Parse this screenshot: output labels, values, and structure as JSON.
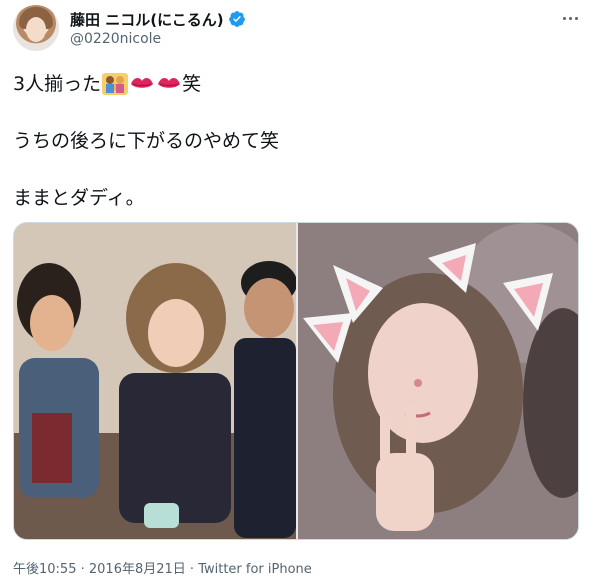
{
  "tweet": {
    "display_name": "藤田 ニコル(にこるん)",
    "handle": "@0220nicole",
    "lines": [
      "3人揃った",
      "笑",
      "うちの後ろに下がるのやめて笑",
      "ままとダディ。"
    ],
    "footer": {
      "time": "午後10:55",
      "date": "2016年8月21日",
      "source": "Twitter for iPhone"
    }
  },
  "icons": {
    "verified": "verified-badge-icon",
    "more": "more-options-icon",
    "family": "family-emoji-icon",
    "kiss": "kiss-mark-emoji-icon"
  },
  "colors": {
    "text": "#0f1419",
    "muted": "#536471",
    "verified": "#1d9bf0",
    "kiss": "#e0245e"
  }
}
